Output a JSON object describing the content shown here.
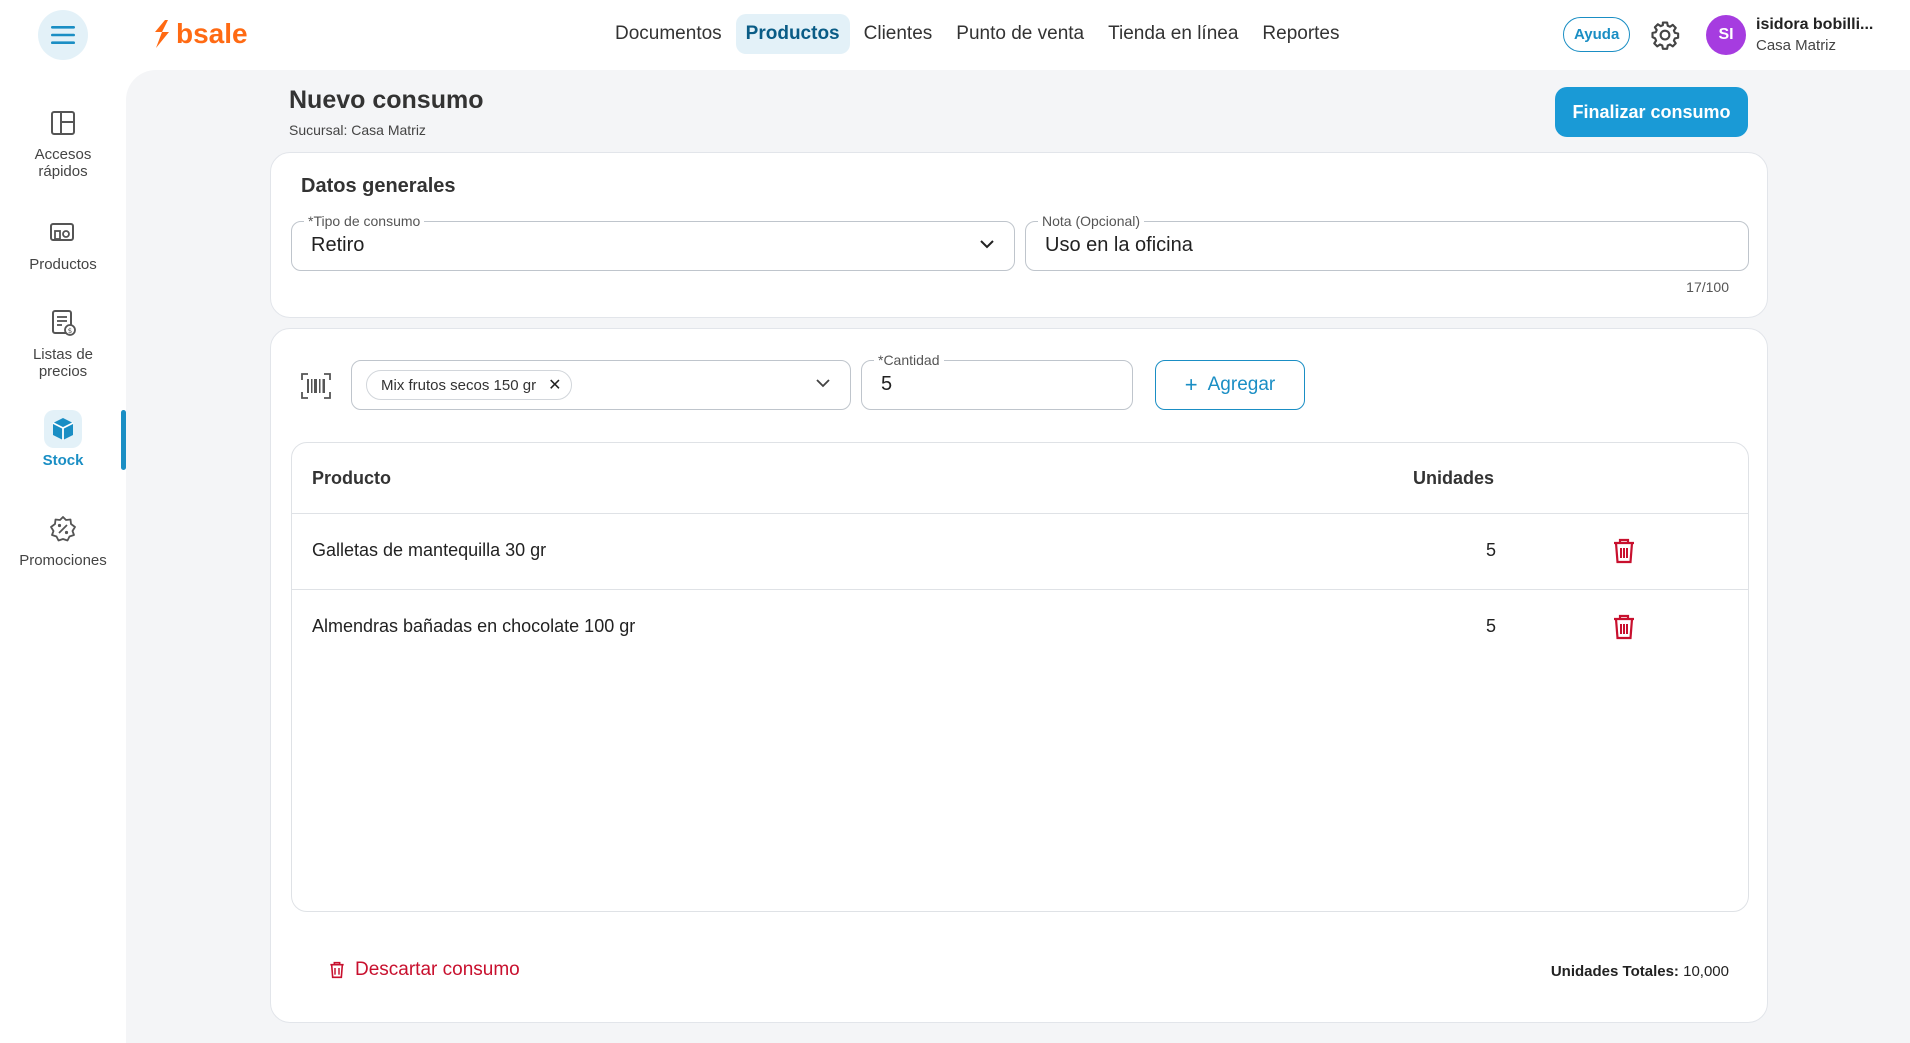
{
  "header": {
    "logo_text": "bsale",
    "nav": [
      "Documentos",
      "Productos",
      "Clientes",
      "Punto de venta",
      "Tienda en línea",
      "Reportes"
    ],
    "active_nav": "Productos",
    "help_label": "Ayuda",
    "avatar_initials": "SI",
    "user_name": "isidora bobilli...",
    "user_branch": "Casa Matriz"
  },
  "sidebar": {
    "items": [
      {
        "label": "Accesos rápidos",
        "icon": "layout-icon"
      },
      {
        "label": "Productos",
        "icon": "products-icon"
      },
      {
        "label": "Listas de precios",
        "icon": "price-list-icon"
      },
      {
        "label": "Stock",
        "icon": "box-icon",
        "active": true
      },
      {
        "label": "Promociones",
        "icon": "promo-icon"
      }
    ]
  },
  "page": {
    "title": "Nuevo consumo",
    "subtitle": "Sucursal: Casa Matriz",
    "finish_label": "Finalizar consumo"
  },
  "general": {
    "title": "Datos generales",
    "tipo_label": "*Tipo de consumo",
    "tipo_value": "Retiro",
    "nota_label": "Nota (Opcional)",
    "nota_value": "Uso en la oficina",
    "nota_counter": "17/100"
  },
  "add": {
    "product_chip": "Mix frutos secos 150 gr",
    "cantidad_label": "*Cantidad",
    "cantidad_value": "5",
    "add_label": "Agregar"
  },
  "table": {
    "headers": {
      "product": "Producto",
      "units": "Unidades"
    },
    "rows": [
      {
        "product": "Galletas de mantequilla 30 gr",
        "units": "5"
      },
      {
        "product": "Almendras bañadas en chocolate 100 gr",
        "units": "5"
      }
    ]
  },
  "footer": {
    "discard_label": "Descartar consumo",
    "totals_label": "Unidades Totales:",
    "totals_value": "10,000"
  },
  "colors": {
    "accent": "#1a9ad6",
    "danger": "#c8102e",
    "brand": "#ff6a13",
    "avatar": "#a63ce0"
  }
}
